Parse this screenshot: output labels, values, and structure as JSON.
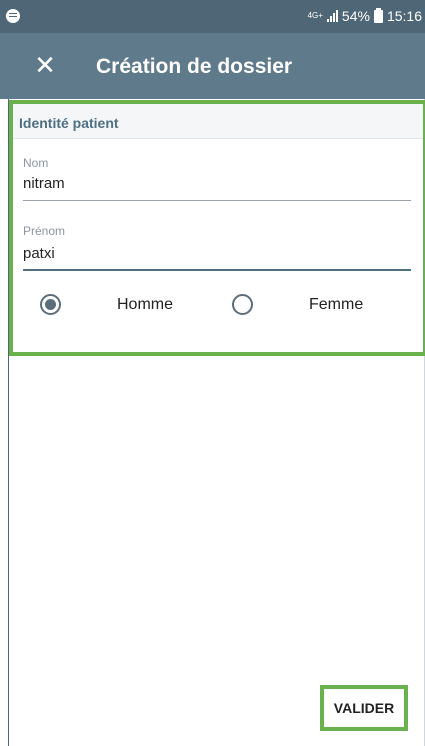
{
  "status_bar": {
    "network": "4G+",
    "battery": "54%",
    "time": "15:16",
    "app_icon": "app-notification-icon"
  },
  "app_bar": {
    "close_icon": "close-icon",
    "close_glyph": "✕",
    "title": "Création de dossier"
  },
  "form": {
    "section_title": "Identité patient",
    "nom": {
      "label": "Nom",
      "value": "nitram"
    },
    "prenom": {
      "label": "Prénom",
      "value": "patxi"
    },
    "gender": {
      "options": [
        {
          "label": "Homme",
          "selected": true
        },
        {
          "label": "Femme",
          "selected": false
        }
      ]
    }
  },
  "actions": {
    "validate_label": "VALIDER"
  },
  "colors": {
    "status_bar": "#4e6676",
    "app_bar": "#5f7a8a",
    "highlight": "#6ab04c",
    "section_header_text": "#4f6f83"
  }
}
